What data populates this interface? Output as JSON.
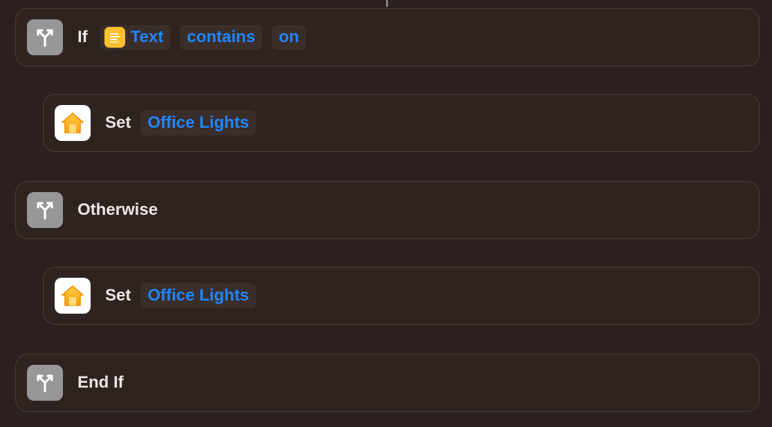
{
  "actions": [
    {
      "verb": "If",
      "icon": "branch-icon",
      "params": [
        {
          "text": "Text",
          "icon": "notes-text-icon"
        },
        {
          "text": "contains"
        },
        {
          "text": "on"
        }
      ]
    },
    {
      "verb": "Set",
      "icon": "home-icon",
      "params": [
        {
          "text": "Office Lights"
        }
      ]
    },
    {
      "verb": "Otherwise",
      "icon": "branch-icon",
      "params": []
    },
    {
      "verb": "Set",
      "icon": "home-icon",
      "params": [
        {
          "text": "Office Lights"
        }
      ]
    },
    {
      "verb": "End If",
      "icon": "branch-icon",
      "params": []
    }
  ],
  "colors": {
    "background": "#2b201d",
    "card": "#2f2320",
    "card_border": "#4a3e3a",
    "accent": "#1f86ff",
    "scripting_icon_bg": "#97979a",
    "home_icon": "#ffb020",
    "notes_icon": "#fbc02d"
  }
}
